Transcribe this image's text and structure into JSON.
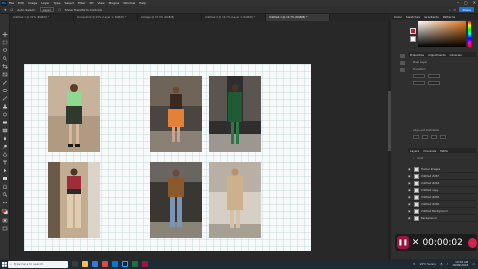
{
  "app": {
    "logo": "Ps",
    "menu": [
      "File",
      "Edit",
      "Image",
      "Layer",
      "Type",
      "Select",
      "Filter",
      "3D",
      "View",
      "Plugins",
      "Window",
      "Help"
    ]
  },
  "options_bar": {
    "auto_select_label": "Auto-Select:",
    "auto_select_value": "Layer",
    "show_transform": "Show Transform Controls",
    "share_label": "Share"
  },
  "tabs": [
    {
      "label": "Untitled-1 @ 21% (RGB/8) *"
    },
    {
      "label": "Screenshot @ 25% (Layer 1, RGB/8) *"
    },
    {
      "label": "Collage @ 33.3% (RGB/8)"
    },
    {
      "label": "Untitled-2 @ 16.7% (Layer 1, RGB/8) *"
    },
    {
      "label": "Untitled-1 @ 12.7% (RGB/8) *"
    }
  ],
  "right_panel": {
    "color_tabs": [
      "Color",
      "Swatches",
      "Gradients",
      "Patterns"
    ],
    "properties_tabs": [
      "Properties",
      "Adjustments",
      "Libraries"
    ],
    "properties_section": "Pixel Layer",
    "transform_label": "Transform",
    "align_label": "Align and Distribute",
    "layers_tabs": [
      "Layers",
      "Channels",
      "Paths"
    ],
    "layers_filter": "Kind",
    "layers": [
      {
        "name": "Trainer Images"
      },
      {
        "name": "Untitled #267"
      },
      {
        "name": "Untitled #264"
      },
      {
        "name": "Untitled copy"
      },
      {
        "name": "Untitled #265"
      },
      {
        "name": "Untitled #260"
      },
      {
        "name": "Untitled Background"
      },
      {
        "name": "Background"
      }
    ]
  },
  "recorder": {
    "time": "00:00:02"
  },
  "taskbar": {
    "search_placeholder": "Type here to search",
    "weather": "19°C Sunny",
    "time": "10:04 AM",
    "date": "18/09/2023"
  },
  "colors": {
    "accent": "#1473e6",
    "record": "#9e1444",
    "foreground": "#b8212b"
  }
}
